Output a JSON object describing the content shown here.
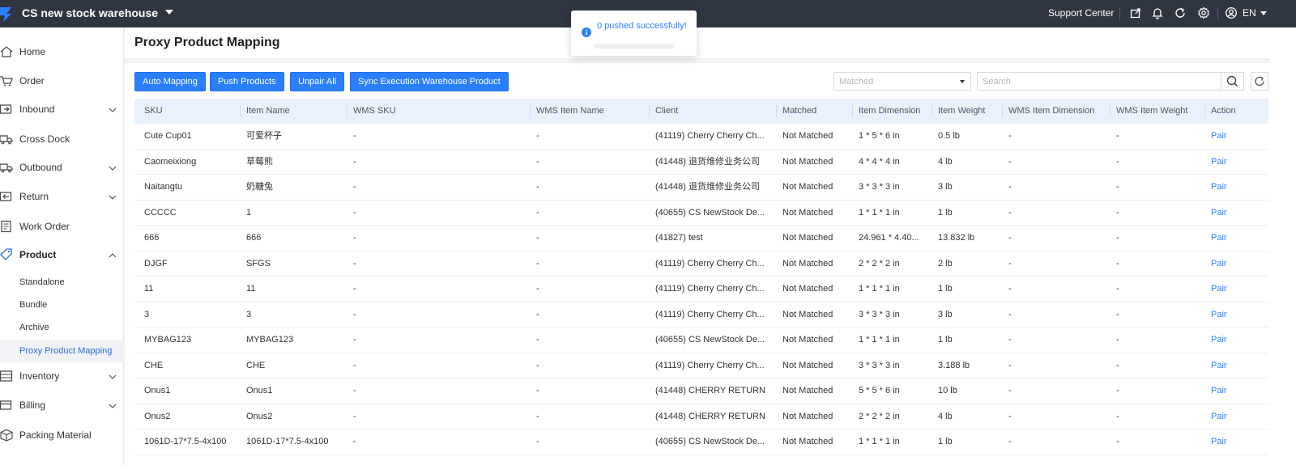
{
  "topbar": {
    "warehouse": "CS new stock warehouse",
    "support": "Support Center",
    "language": "EN",
    "icons": [
      "export-icon",
      "bell-icon",
      "refresh-icon",
      "settings-icon",
      "user-icon"
    ]
  },
  "sidebar": {
    "items": [
      {
        "label": "Home",
        "icon": "home-icon",
        "expandable": false
      },
      {
        "label": "Order",
        "icon": "cart-icon",
        "expandable": false
      },
      {
        "label": "Inbound",
        "icon": "inbound-icon",
        "expandable": true
      },
      {
        "label": "Cross Dock",
        "icon": "truck-icon",
        "expandable": false
      },
      {
        "label": "Outbound",
        "icon": "outbound-truck-icon",
        "expandable": true
      },
      {
        "label": "Return",
        "icon": "return-icon",
        "expandable": true
      },
      {
        "label": "Work Order",
        "icon": "work-order-icon",
        "expandable": false
      },
      {
        "label": "Product",
        "icon": "tag-icon",
        "expandable": true,
        "expanded": true
      },
      {
        "label": "Inventory",
        "icon": "inventory-icon",
        "expandable": true
      },
      {
        "label": "Billing",
        "icon": "billing-icon",
        "expandable": true
      },
      {
        "label": "Packing Material",
        "icon": "box-icon",
        "expandable": false
      }
    ],
    "product_sub": [
      "Standalone",
      "Bundle",
      "Archive",
      "Proxy Product Mapping"
    ],
    "active_sub": "Proxy Product Mapping"
  },
  "page": {
    "title": "Proxy Product Mapping"
  },
  "toolbar": {
    "buttons": [
      "Auto Mapping",
      "Push Products",
      "Unpair All",
      "Sync Execution Warehouse Product"
    ],
    "filter_placeholder": "Matched",
    "search_placeholder": "Search"
  },
  "toast": {
    "message": "0 pushed successfully!"
  },
  "table": {
    "columns": [
      "SKU",
      "Item Name",
      "WMS SKU",
      "WMS Item Name",
      "Client",
      "Matched",
      "Item Dimension",
      "Item Weight",
      "WMS Item Dimension",
      "WMS Item Weight",
      "Action"
    ],
    "rows": [
      [
        "Cute Cup01",
        "可爱杯子",
        "-",
        "-",
        "(41119) Cherry Cherry Ch...",
        "Not Matched",
        "1 * 5 * 6 in",
        "0.5 lb",
        "-",
        "-",
        "Pair"
      ],
      [
        "Caomeixiong",
        "草莓熊",
        "-",
        "-",
        "(41448) 退货维修业务公司",
        "Not Matched",
        "4 * 4 * 4 in",
        "4 lb",
        "-",
        "-",
        "Pair"
      ],
      [
        "Naitangtu",
        "奶糖兔",
        "-",
        "-",
        "(41448) 退货维修业务公司",
        "Not Matched",
        "3 * 3 * 3 in",
        "3 lb",
        "-",
        "-",
        "Pair"
      ],
      [
        "CCCCC",
        "1",
        "-",
        "-",
        "(40655) CS NewStock De...",
        "Not Matched",
        "1 * 1 * 1 in",
        "1 lb",
        "-",
        "-",
        "Pair"
      ],
      [
        "666",
        "666",
        "-",
        "-",
        "(41827) test",
        "Not Matched",
        "24.961 * 4.40...",
        "13.832 lb",
        "-",
        "-",
        "Pair"
      ],
      [
        "DJGF",
        "SFGS",
        "-",
        "-",
        "(41119) Cherry Cherry Ch...",
        "Not Matched",
        "2 * 2 * 2 in",
        "2 lb",
        "-",
        "-",
        "Pair"
      ],
      [
        "11",
        "11",
        "-",
        "-",
        "(41119) Cherry Cherry Ch...",
        "Not Matched",
        "1 * 1 * 1 in",
        "1 lb",
        "-",
        "-",
        "Pair"
      ],
      [
        "3",
        "3",
        "-",
        "-",
        "(41119) Cherry Cherry Ch...",
        "Not Matched",
        "3 * 3 * 3 in",
        "3 lb",
        "-",
        "-",
        "Pair"
      ],
      [
        "MYBAG123",
        "MYBAG123",
        "-",
        "-",
        "(40655) CS NewStock De...",
        "Not Matched",
        "1 * 1 * 1 in",
        "1 lb",
        "-",
        "-",
        "Pair"
      ],
      [
        "CHE",
        "CHE",
        "-",
        "-",
        "(41119) Cherry Cherry Ch...",
        "Not Matched",
        "3 * 3 * 3 in",
        "3.188 lb",
        "-",
        "-",
        "Pair"
      ],
      [
        "Onus1",
        "Onus1",
        "-",
        "-",
        "(41448) CHERRY RETURN",
        "Not Matched",
        "5 * 5 * 6 in",
        "10 lb",
        "-",
        "-",
        "Pair"
      ],
      [
        "Onus2",
        "Onus2",
        "-",
        "-",
        "(41448) CHERRY RETURN",
        "Not Matched",
        "2 * 2 * 2 in",
        "4 lb",
        "-",
        "-",
        "Pair"
      ],
      [
        "1061D-17*7.5-4x100",
        "1061D-17*7.5-4x100",
        "-",
        "-",
        "(40655) CS NewStock De...",
        "Not Matched",
        "1 * 1 * 1 in",
        "1 lb",
        "-",
        "-",
        "Pair"
      ]
    ]
  },
  "colors": {
    "topbar": "#2f3641",
    "primary": "#2a7fff",
    "header_row": "#e9f1fd",
    "active_nav": "#2a6fd6"
  }
}
